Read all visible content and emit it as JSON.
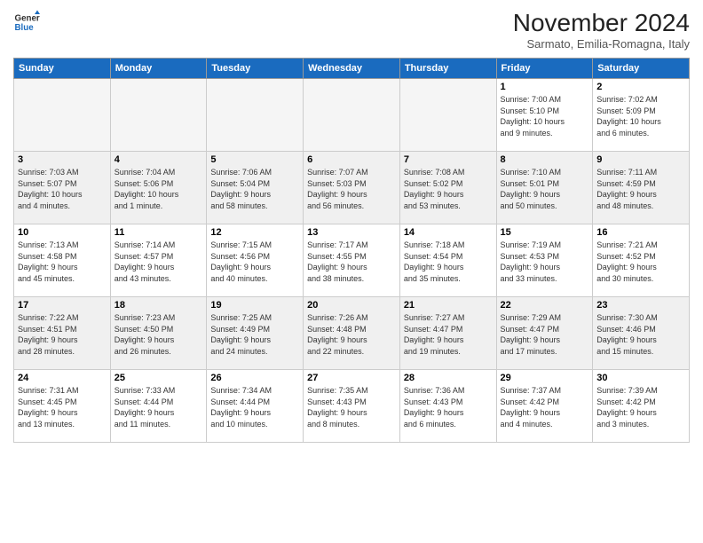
{
  "logo": {
    "line1": "General",
    "line2": "Blue"
  },
  "title": "November 2024",
  "subtitle": "Sarmato, Emilia-Romagna, Italy",
  "days_of_week": [
    "Sunday",
    "Monday",
    "Tuesday",
    "Wednesday",
    "Thursday",
    "Friday",
    "Saturday"
  ],
  "weeks": [
    {
      "shaded": false,
      "days": [
        {
          "day": "",
          "info": "",
          "empty": true
        },
        {
          "day": "",
          "info": "",
          "empty": true
        },
        {
          "day": "",
          "info": "",
          "empty": true
        },
        {
          "day": "",
          "info": "",
          "empty": true
        },
        {
          "day": "",
          "info": "",
          "empty": true
        },
        {
          "day": "1",
          "info": "Sunrise: 7:00 AM\nSunset: 5:10 PM\nDaylight: 10 hours\nand 9 minutes.",
          "empty": false
        },
        {
          "day": "2",
          "info": "Sunrise: 7:02 AM\nSunset: 5:09 PM\nDaylight: 10 hours\nand 6 minutes.",
          "empty": false
        }
      ]
    },
    {
      "shaded": true,
      "days": [
        {
          "day": "3",
          "info": "Sunrise: 7:03 AM\nSunset: 5:07 PM\nDaylight: 10 hours\nand 4 minutes.",
          "empty": false
        },
        {
          "day": "4",
          "info": "Sunrise: 7:04 AM\nSunset: 5:06 PM\nDaylight: 10 hours\nand 1 minute.",
          "empty": false
        },
        {
          "day": "5",
          "info": "Sunrise: 7:06 AM\nSunset: 5:04 PM\nDaylight: 9 hours\nand 58 minutes.",
          "empty": false
        },
        {
          "day": "6",
          "info": "Sunrise: 7:07 AM\nSunset: 5:03 PM\nDaylight: 9 hours\nand 56 minutes.",
          "empty": false
        },
        {
          "day": "7",
          "info": "Sunrise: 7:08 AM\nSunset: 5:02 PM\nDaylight: 9 hours\nand 53 minutes.",
          "empty": false
        },
        {
          "day": "8",
          "info": "Sunrise: 7:10 AM\nSunset: 5:01 PM\nDaylight: 9 hours\nand 50 minutes.",
          "empty": false
        },
        {
          "day": "9",
          "info": "Sunrise: 7:11 AM\nSunset: 4:59 PM\nDaylight: 9 hours\nand 48 minutes.",
          "empty": false
        }
      ]
    },
    {
      "shaded": false,
      "days": [
        {
          "day": "10",
          "info": "Sunrise: 7:13 AM\nSunset: 4:58 PM\nDaylight: 9 hours\nand 45 minutes.",
          "empty": false
        },
        {
          "day": "11",
          "info": "Sunrise: 7:14 AM\nSunset: 4:57 PM\nDaylight: 9 hours\nand 43 minutes.",
          "empty": false
        },
        {
          "day": "12",
          "info": "Sunrise: 7:15 AM\nSunset: 4:56 PM\nDaylight: 9 hours\nand 40 minutes.",
          "empty": false
        },
        {
          "day": "13",
          "info": "Sunrise: 7:17 AM\nSunset: 4:55 PM\nDaylight: 9 hours\nand 38 minutes.",
          "empty": false
        },
        {
          "day": "14",
          "info": "Sunrise: 7:18 AM\nSunset: 4:54 PM\nDaylight: 9 hours\nand 35 minutes.",
          "empty": false
        },
        {
          "day": "15",
          "info": "Sunrise: 7:19 AM\nSunset: 4:53 PM\nDaylight: 9 hours\nand 33 minutes.",
          "empty": false
        },
        {
          "day": "16",
          "info": "Sunrise: 7:21 AM\nSunset: 4:52 PM\nDaylight: 9 hours\nand 30 minutes.",
          "empty": false
        }
      ]
    },
    {
      "shaded": true,
      "days": [
        {
          "day": "17",
          "info": "Sunrise: 7:22 AM\nSunset: 4:51 PM\nDaylight: 9 hours\nand 28 minutes.",
          "empty": false
        },
        {
          "day": "18",
          "info": "Sunrise: 7:23 AM\nSunset: 4:50 PM\nDaylight: 9 hours\nand 26 minutes.",
          "empty": false
        },
        {
          "day": "19",
          "info": "Sunrise: 7:25 AM\nSunset: 4:49 PM\nDaylight: 9 hours\nand 24 minutes.",
          "empty": false
        },
        {
          "day": "20",
          "info": "Sunrise: 7:26 AM\nSunset: 4:48 PM\nDaylight: 9 hours\nand 22 minutes.",
          "empty": false
        },
        {
          "day": "21",
          "info": "Sunrise: 7:27 AM\nSunset: 4:47 PM\nDaylight: 9 hours\nand 19 minutes.",
          "empty": false
        },
        {
          "day": "22",
          "info": "Sunrise: 7:29 AM\nSunset: 4:47 PM\nDaylight: 9 hours\nand 17 minutes.",
          "empty": false
        },
        {
          "day": "23",
          "info": "Sunrise: 7:30 AM\nSunset: 4:46 PM\nDaylight: 9 hours\nand 15 minutes.",
          "empty": false
        }
      ]
    },
    {
      "shaded": false,
      "days": [
        {
          "day": "24",
          "info": "Sunrise: 7:31 AM\nSunset: 4:45 PM\nDaylight: 9 hours\nand 13 minutes.",
          "empty": false
        },
        {
          "day": "25",
          "info": "Sunrise: 7:33 AM\nSunset: 4:44 PM\nDaylight: 9 hours\nand 11 minutes.",
          "empty": false
        },
        {
          "day": "26",
          "info": "Sunrise: 7:34 AM\nSunset: 4:44 PM\nDaylight: 9 hours\nand 10 minutes.",
          "empty": false
        },
        {
          "day": "27",
          "info": "Sunrise: 7:35 AM\nSunset: 4:43 PM\nDaylight: 9 hours\nand 8 minutes.",
          "empty": false
        },
        {
          "day": "28",
          "info": "Sunrise: 7:36 AM\nSunset: 4:43 PM\nDaylight: 9 hours\nand 6 minutes.",
          "empty": false
        },
        {
          "day": "29",
          "info": "Sunrise: 7:37 AM\nSunset: 4:42 PM\nDaylight: 9 hours\nand 4 minutes.",
          "empty": false
        },
        {
          "day": "30",
          "info": "Sunrise: 7:39 AM\nSunset: 4:42 PM\nDaylight: 9 hours\nand 3 minutes.",
          "empty": false
        }
      ]
    }
  ]
}
